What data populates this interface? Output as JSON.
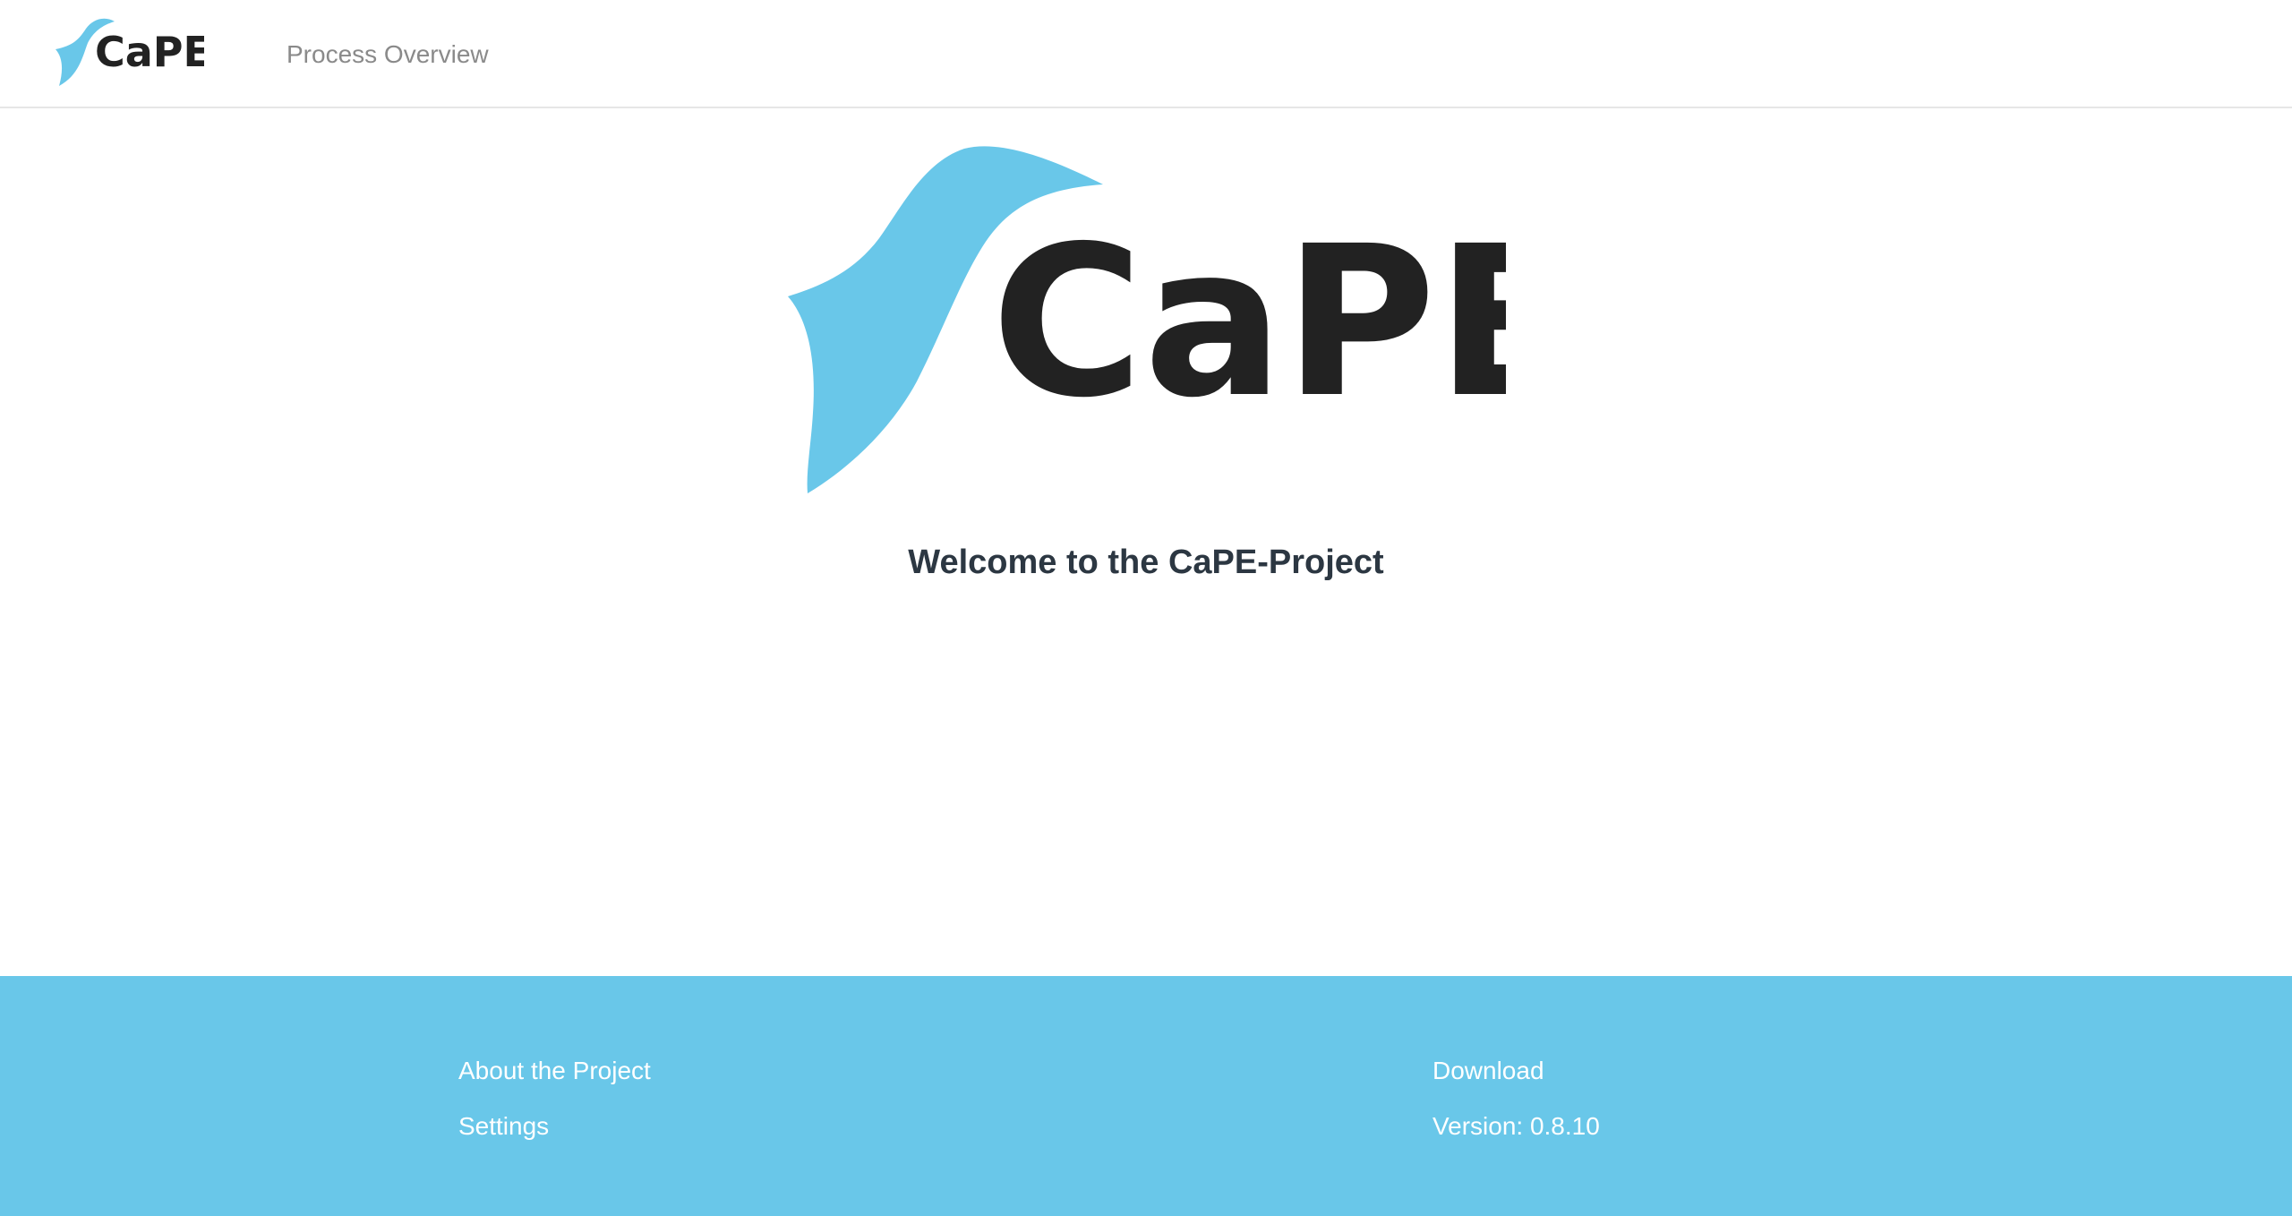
{
  "header": {
    "logo_text": "CaPE",
    "nav_process_overview": "Process Overview"
  },
  "hero": {
    "logo_text": "CaPE",
    "welcome_title": "Welcome to the CaPE-Project"
  },
  "footer": {
    "about_label": "About the Project",
    "settings_label": "Settings",
    "download_label": "Download",
    "version_prefix": "Version:",
    "version_value": "0.8.10"
  },
  "colors": {
    "brand_blue": "#69c7e9",
    "logo_text": "#222222",
    "heading": "#2c3742",
    "nav_link": "#8a8a8a"
  },
  "icons": {
    "logo": "cape-bird-logo-icon"
  }
}
